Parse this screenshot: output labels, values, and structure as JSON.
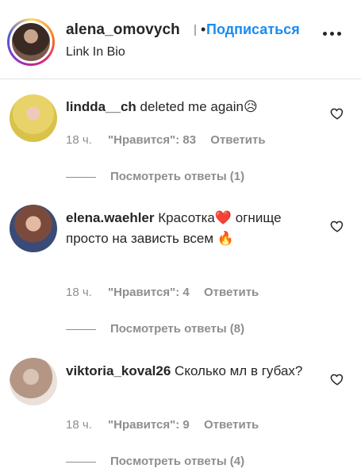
{
  "header": {
    "username": "alena_omovych",
    "separator": "•",
    "follow_label": "Подписаться",
    "bio": "Link In Bio",
    "more_icon": "more-horizontal-icon"
  },
  "comments": [
    {
      "username": "lindda__ch",
      "text": "deleted me again😥",
      "time": "18 ч.",
      "likes": "\"Нравится\": 83",
      "reply_label": "Ответить",
      "view_replies": "Посмотреть ответы (1)"
    },
    {
      "username": "elena.waehler",
      "text": "Красотка❤️ огнище просто на зависть всем 🔥",
      "time": "18 ч.",
      "likes": "\"Нравится\": 4",
      "reply_label": "Ответить",
      "view_replies": "Посмотреть ответы (8)"
    },
    {
      "username": "viktoria_koval26",
      "text": "Сколько мл в губах?",
      "time": "18 ч.",
      "likes": "\"Нравится\": 9",
      "reply_label": "Ответить",
      "view_replies": "Посмотреть ответы (4)"
    }
  ],
  "colors": {
    "follow": "#1a8cf0",
    "meta": "#8e8e8e",
    "text": "#262626"
  }
}
